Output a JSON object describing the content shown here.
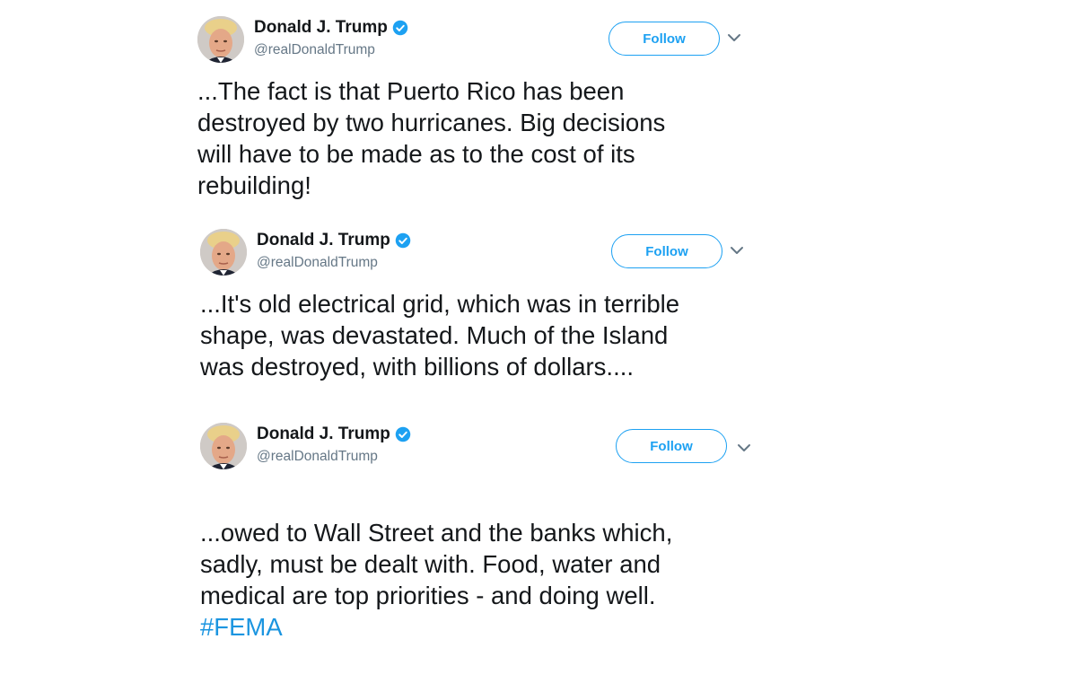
{
  "tweets": [
    {
      "author": {
        "name": "Donald J. Trump",
        "handle": "@realDonaldTrump",
        "verified": true
      },
      "follow_label": "Follow",
      "text": "...The fact is that Puerto Rico has been\ndestroyed by two hurricanes. Big decisions\nwill have to be made as to the cost of its\nrebuilding!"
    },
    {
      "author": {
        "name": "Donald J. Trump",
        "handle": "@realDonaldTrump",
        "verified": true
      },
      "follow_label": "Follow",
      "text": "...It's old electrical grid, which was in terrible\nshape, was devastated. Much of the Island\nwas destroyed, with billions of dollars...."
    },
    {
      "author": {
        "name": "Donald J. Trump",
        "handle": "@realDonaldTrump",
        "verified": true
      },
      "follow_label": "Follow",
      "text": "...owed to Wall Street and the banks which,\nsadly, must be dealt with. Food, water and\nmedical are top priorities - and doing well.",
      "hashtag": "#FEMA"
    }
  ],
  "colors": {
    "accent": "#1da1f2",
    "hashtag": "#1b95e0",
    "text": "#14171a",
    "muted": "#657786",
    "verified": "#1da1f2"
  },
  "icons": {
    "verified": "verified-badge-icon",
    "menu": "chevron-down-icon",
    "avatar": "profile-photo"
  }
}
